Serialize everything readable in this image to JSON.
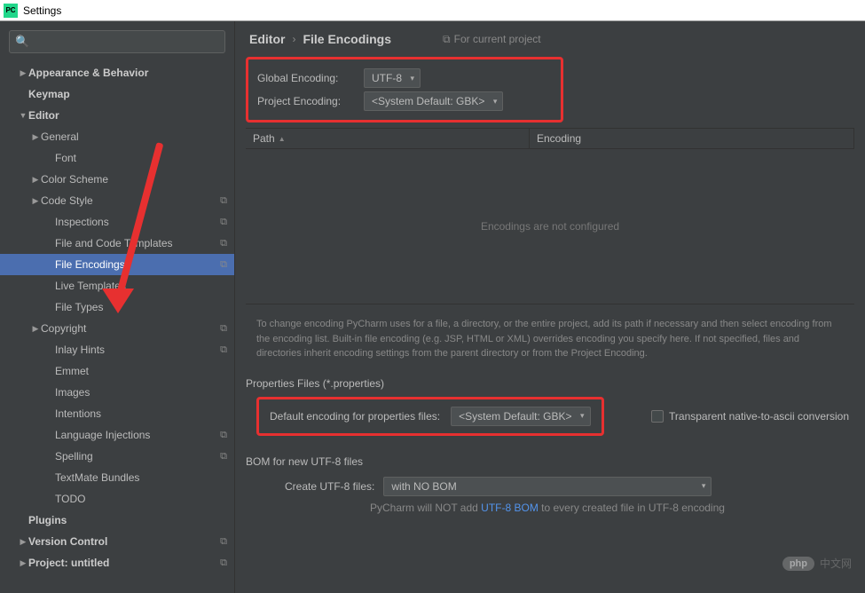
{
  "titlebar": {
    "icon_text": "PC",
    "title": "Settings"
  },
  "sidebar": {
    "items": [
      {
        "label": "Appearance & Behavior",
        "depth": 0,
        "expand": "▶",
        "bold": true
      },
      {
        "label": "Keymap",
        "depth": 0,
        "bold": true
      },
      {
        "label": "Editor",
        "depth": 0,
        "expand": "▼",
        "bold": true
      },
      {
        "label": "General",
        "depth": 1,
        "expand": "▶"
      },
      {
        "label": "Font",
        "depth": 2
      },
      {
        "label": "Color Scheme",
        "depth": 1,
        "expand": "▶"
      },
      {
        "label": "Code Style",
        "depth": 1,
        "expand": "▶",
        "copy": true
      },
      {
        "label": "Inspections",
        "depth": 2,
        "copy": true
      },
      {
        "label": "File and Code Templates",
        "depth": 2,
        "copy": true
      },
      {
        "label": "File Encodings",
        "depth": 2,
        "copy": true,
        "selected": true
      },
      {
        "label": "Live Templates",
        "depth": 2
      },
      {
        "label": "File Types",
        "depth": 2
      },
      {
        "label": "Copyright",
        "depth": 1,
        "expand": "▶",
        "copy": true
      },
      {
        "label": "Inlay Hints",
        "depth": 2,
        "copy": true
      },
      {
        "label": "Emmet",
        "depth": 2
      },
      {
        "label": "Images",
        "depth": 2
      },
      {
        "label": "Intentions",
        "depth": 2
      },
      {
        "label": "Language Injections",
        "depth": 2,
        "copy": true
      },
      {
        "label": "Spelling",
        "depth": 2,
        "copy": true
      },
      {
        "label": "TextMate Bundles",
        "depth": 2
      },
      {
        "label": "TODO",
        "depth": 2
      },
      {
        "label": "Plugins",
        "depth": 0,
        "bold": true
      },
      {
        "label": "Version Control",
        "depth": 0,
        "expand": "▶",
        "bold": true,
        "copy": true
      },
      {
        "label": "Project: untitled",
        "depth": 0,
        "expand": "▶",
        "bold": true,
        "copy": true
      }
    ]
  },
  "breadcrumb": {
    "main": "Editor",
    "sep": "›",
    "sub": "File Encodings",
    "for_project": "For current project"
  },
  "encodings": {
    "global_label": "Global Encoding:",
    "global_value": "UTF-8",
    "project_label": "Project Encoding:",
    "project_value": "<System Default: GBK>"
  },
  "table": {
    "col_path": "Path",
    "col_encoding": "Encoding",
    "empty_text": "Encodings are not configured"
  },
  "info_text": "To change encoding PyCharm uses for a file, a directory, or the entire project, add its path if necessary and then select encoding from the encoding list. Built-in file encoding (e.g. JSP, HTML or XML) overrides encoding you specify here. If not specified, files and directories inherit encoding settings from the parent directory or from the Project Encoding.",
  "properties": {
    "section": "Properties Files (*.properties)",
    "label": "Default encoding for properties files:",
    "value": "<System Default: GBK>",
    "checkbox_label": "Transparent native-to-ascii conversion"
  },
  "bom": {
    "section": "BOM for new UTF-8 files",
    "label": "Create UTF-8 files:",
    "value": "with NO BOM",
    "note_pre": "PyCharm will NOT add ",
    "note_link": "UTF-8 BOM",
    "note_post": " to every created file in UTF-8 encoding"
  },
  "watermark": {
    "badge": "php",
    "text": "中文网"
  }
}
